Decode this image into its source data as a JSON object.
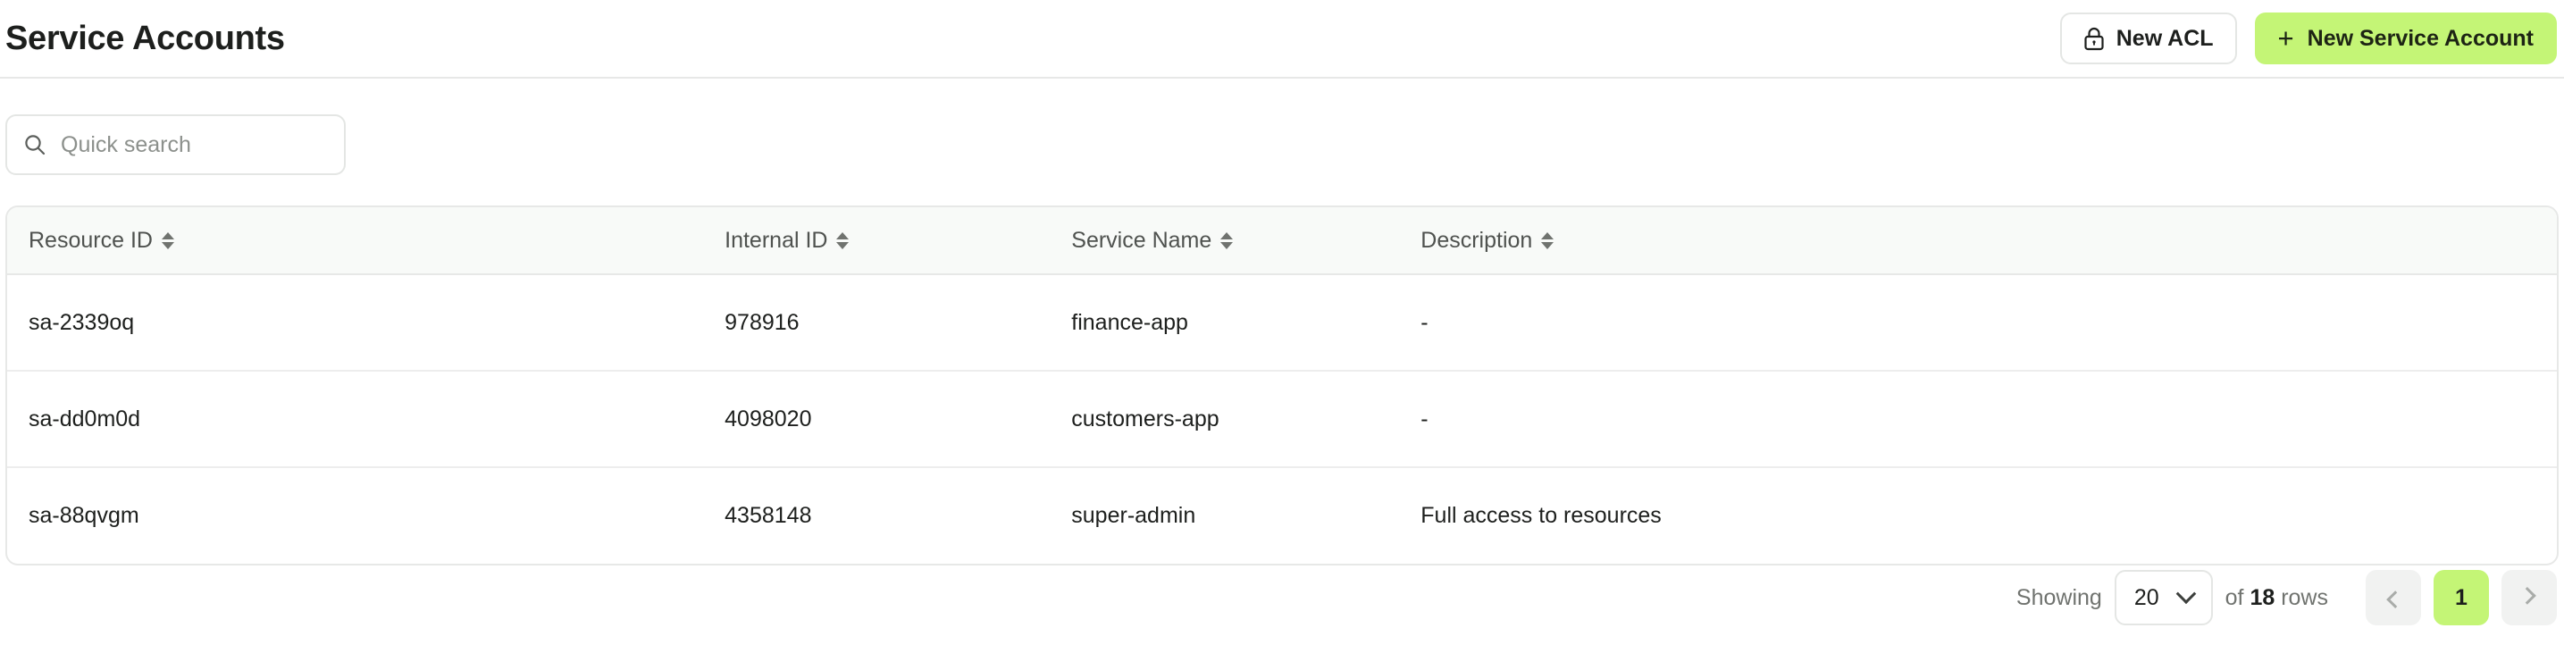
{
  "header": {
    "title": "Service Accounts",
    "buttons": {
      "acl_label": "New ACL",
      "acl_icon": "lock-icon",
      "new_label": "New Service Account",
      "new_icon": "plus-icon",
      "new_bg_color": "#c4f576"
    }
  },
  "search": {
    "placeholder": "Quick search",
    "value": "",
    "icon": "search-icon"
  },
  "table": {
    "columns": [
      {
        "label": "Resource ID",
        "sort_icon": "sort-arrows-icon"
      },
      {
        "label": "Internal ID",
        "sort_icon": "sort-arrows-icon"
      },
      {
        "label": "Service Name",
        "sort_icon": "sort-arrows-icon"
      },
      {
        "label": "Description",
        "sort_icon": "sort-arrows-icon"
      }
    ],
    "rows": [
      {
        "resource_id": "sa-2339oq",
        "internal_id": "978916",
        "service_name": "finance-app",
        "description": "-"
      },
      {
        "resource_id": "sa-dd0m0d",
        "internal_id": "4098020",
        "service_name": "customers-app",
        "description": "-"
      },
      {
        "resource_id": "sa-88qvgm",
        "internal_id": "4358148",
        "service_name": "super-admin",
        "description": "Full access to resources"
      }
    ]
  },
  "pagination": {
    "showing_label": "Showing",
    "page_size": "20",
    "of_label": "of",
    "total_rows": "18",
    "rows_label": "rows",
    "prev_icon": "chevron-left-icon",
    "next_icon": "chevron-right-icon",
    "current_page": "1",
    "active_bg_color": "#c4f576"
  }
}
